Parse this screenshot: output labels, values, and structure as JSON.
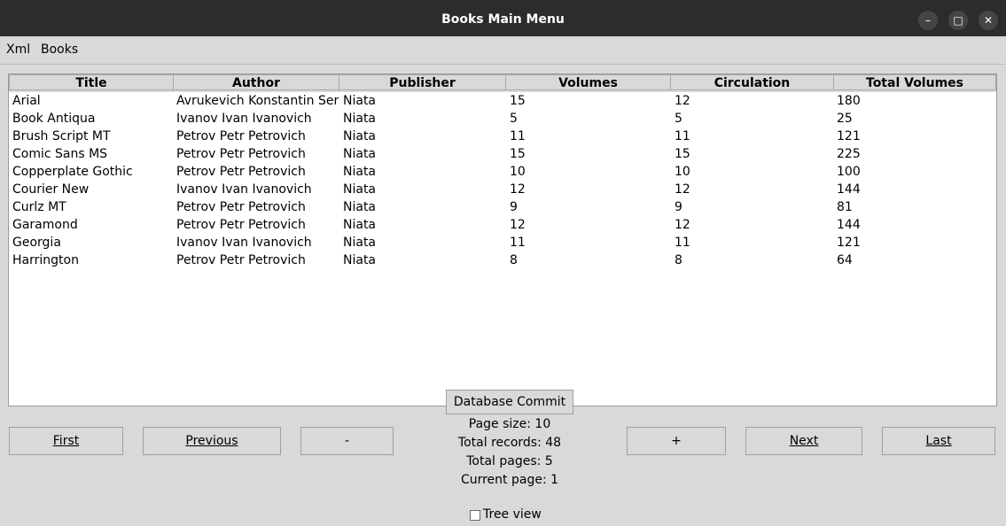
{
  "window": {
    "title": "Books Main Menu",
    "minimize": "–",
    "maximize": "□",
    "close": "✕"
  },
  "menu": [
    "Xml",
    "Books"
  ],
  "table": {
    "columns": [
      "Title",
      "Author",
      "Publisher",
      "Volumes",
      "Circulation",
      "Total Volumes"
    ],
    "rows": [
      [
        "Arial",
        "Avrukevich Konstantin Serg",
        "Niata",
        "15",
        "12",
        "180"
      ],
      [
        "Book Antiqua",
        "Ivanov Ivan Ivanovich",
        "Niata",
        "5",
        "5",
        "25"
      ],
      [
        "Brush Script MT",
        "Petrov Petr Petrovich",
        "Niata",
        "11",
        "11",
        "121"
      ],
      [
        "Comic Sans MS",
        "Petrov Petr Petrovich",
        "Niata",
        "15",
        "15",
        "225"
      ],
      [
        "Copperplate Gothic",
        "Petrov Petr Petrovich",
        "Niata",
        "10",
        "10",
        "100"
      ],
      [
        "Courier New",
        "Ivanov Ivan Ivanovich",
        "Niata",
        "12",
        "12",
        "144"
      ],
      [
        "Curlz MT",
        "Petrov Petr Petrovich",
        "Niata",
        "9",
        "9",
        "81"
      ],
      [
        "Garamond",
        "Petrov Petr Petrovich",
        "Niata",
        "12",
        "12",
        "144"
      ],
      [
        "Georgia",
        "Ivanov Ivan Ivanovich",
        "Niata",
        "11",
        "11",
        "121"
      ],
      [
        "Harrington",
        "Petrov Petr Petrovich",
        "Niata",
        "8",
        "8",
        "64"
      ]
    ]
  },
  "controls": {
    "commit": "Database Commit",
    "first": "First",
    "previous": "Previous",
    "minus": "-",
    "plus": "+",
    "next": "Next",
    "last": "Last"
  },
  "pagination": {
    "page_size": "Page size:  10",
    "total_records": "Total records:  48",
    "total_pages": "Total pages:  5",
    "current_page": "Current page:  1"
  },
  "tree_view": {
    "label": "Tree view",
    "checked": false
  }
}
